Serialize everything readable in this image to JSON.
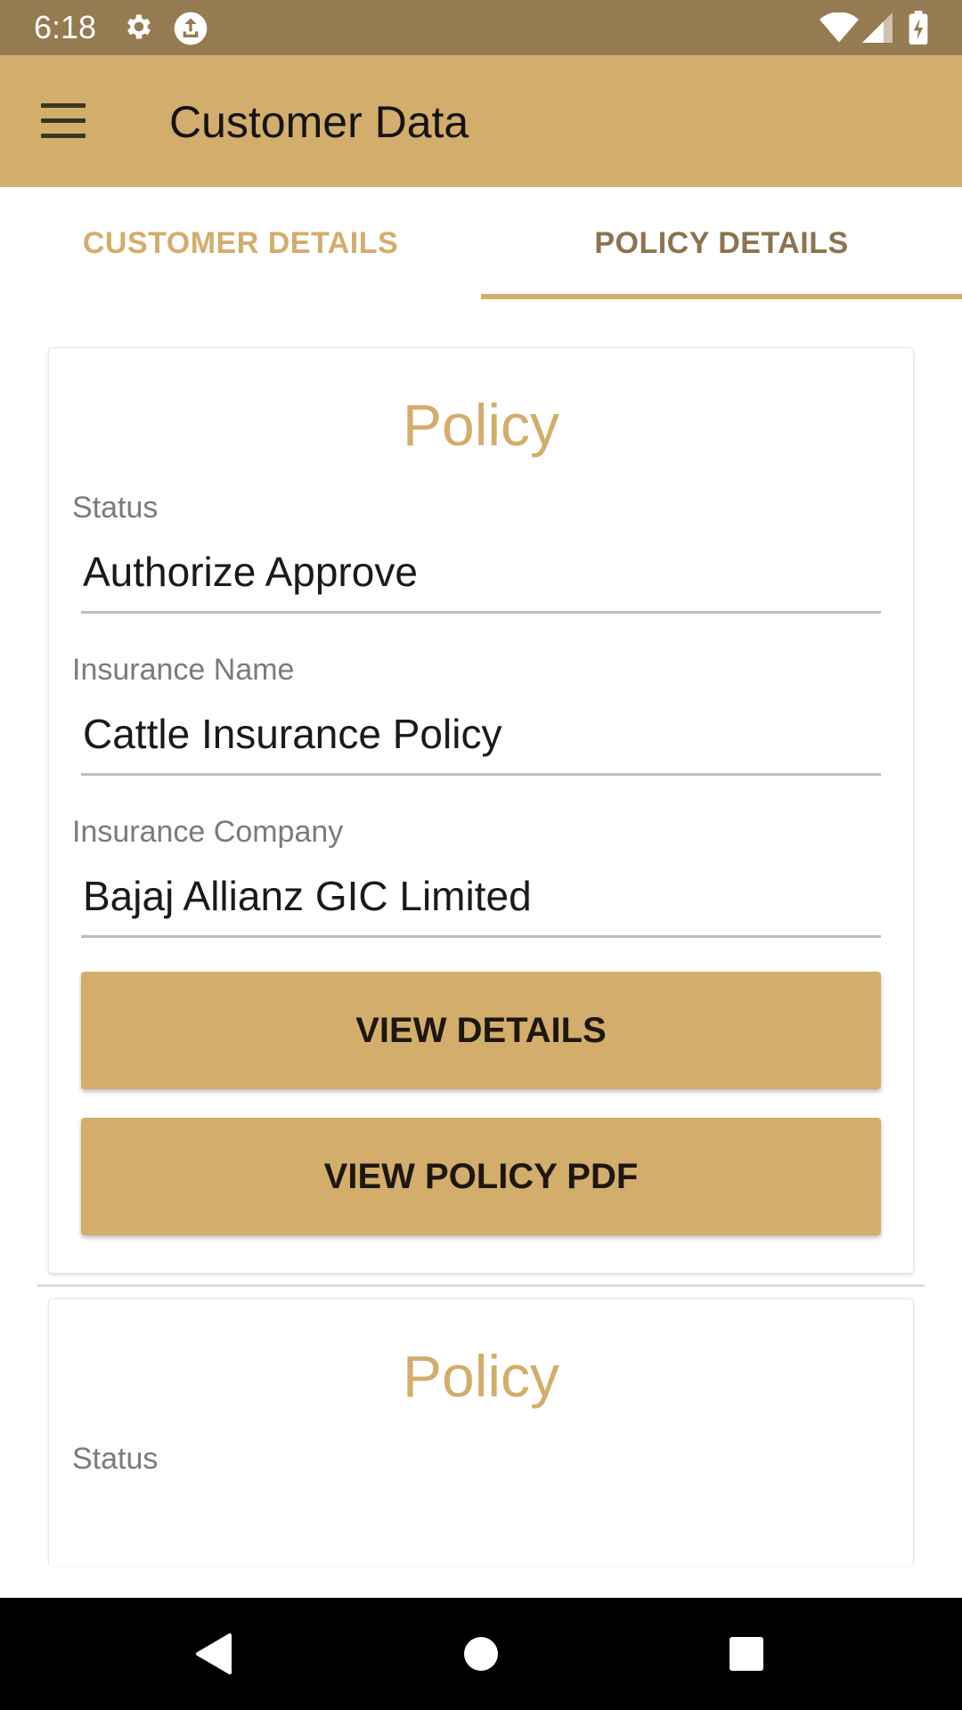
{
  "status_bar": {
    "time": "6:18",
    "icons": [
      "gear-icon",
      "upload-icon",
      "wifi-icon",
      "signal-icon",
      "battery-icon"
    ]
  },
  "app_bar": {
    "title": "Customer Data",
    "menu_icon": "hamburger-menu-icon"
  },
  "tabs": [
    {
      "label": "CUSTOMER DETAILS",
      "selected": false
    },
    {
      "label": "POLICY DETAILS",
      "selected": true
    }
  ],
  "cards": [
    {
      "title": "Policy",
      "fields": [
        {
          "label": "Status",
          "value": "Authorize Approve"
        },
        {
          "label": "Insurance Name",
          "value": "Cattle Insurance Policy"
        },
        {
          "label": "Insurance Company",
          "value": "Bajaj Allianz GIC Limited"
        }
      ],
      "buttons": [
        "VIEW DETAILS",
        "VIEW POLICY PDF"
      ]
    },
    {
      "title": "Policy",
      "fields": [
        {
          "label": "Status",
          "value": ""
        }
      ]
    }
  ],
  "nav_bar": {
    "icons": [
      "back-icon",
      "home-icon",
      "recents-icon"
    ]
  },
  "colors": {
    "status_bar": "#957b51",
    "app_bar": "#d3ad6c",
    "accent": "#d3ad6c",
    "tab_selected_text": "#8c7350",
    "nav_bar": "#000000"
  }
}
